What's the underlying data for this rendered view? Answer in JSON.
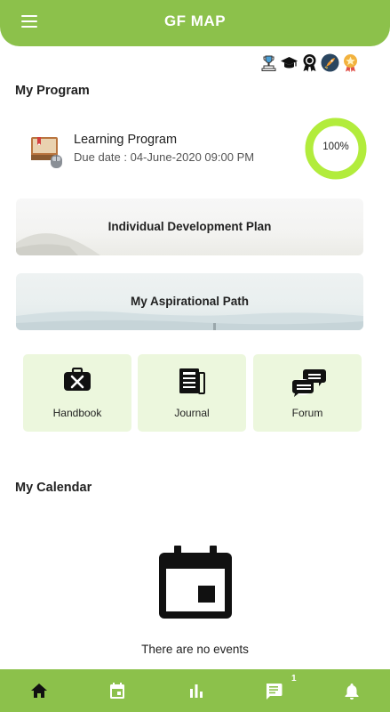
{
  "app": {
    "title": "GF MAP"
  },
  "icons": {
    "menu": "hamburger-menu-icon",
    "badges": [
      "trophy-badge-icon",
      "graduation-cap-badge-icon",
      "rosette-badge-icon",
      "rocket-badge-icon",
      "star-medal-badge-icon"
    ]
  },
  "program": {
    "section_title": "My Program",
    "name": "Learning Program",
    "due": "Due date : 04-June-2020 09:00 PM",
    "progress_label": "100%",
    "progress": 1.0
  },
  "banners": {
    "idp": "Individual Development Plan",
    "path": "My Aspirational Path"
  },
  "tiles": {
    "handbook": "Handbook",
    "journal": "Journal",
    "forum": "Forum"
  },
  "calendar": {
    "section_title": "My Calendar",
    "empty_text": "There are no events"
  },
  "nav": {
    "items": [
      "home-icon",
      "calendar-icon",
      "stats-icon",
      "chat-icon",
      "bell-icon"
    ],
    "chat_badge": "1"
  },
  "colors": {
    "primary": "#8cc14b",
    "progress_ring": "#b2ec3c",
    "tile_bg": "#ecf7dd"
  }
}
